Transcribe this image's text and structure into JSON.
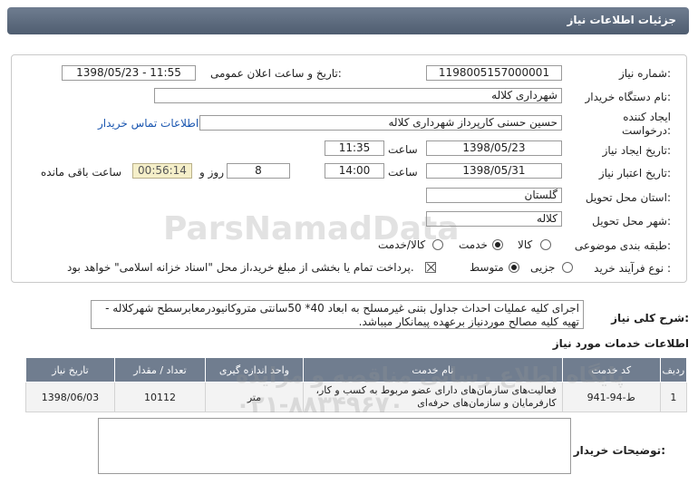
{
  "header": {
    "title": "جزئیات اطلاعات نیاز"
  },
  "form": {
    "need_number": {
      "label": "شماره نیاز:",
      "value": "1198005157000001"
    },
    "announce": {
      "label": "تاریخ و ساعت اعلان عمومی:",
      "value": "1398/05/23 - 11:55"
    },
    "buyer_org": {
      "label": "نام دستگاه خریدار:",
      "value": "شهرداری کلاله"
    },
    "creator": {
      "label_line1": "ایجاد کننده",
      "label_line2": "درخواست:",
      "value": "حسین حسنی کارپرداز شهرداری کلاله",
      "contact_link": "اطلاعات تماس خریدار"
    },
    "created": {
      "label": "تاریخ ایجاد نیاز:",
      "date": "1398/05/23",
      "time_label": "ساعت",
      "time": "11:35"
    },
    "validity": {
      "label": "تاریخ اعتبار نیاز:",
      "date": "1398/05/31",
      "time_label": "ساعت",
      "time": "14:00",
      "days": "8",
      "days_label": "روز و",
      "remaining": "00:56:14",
      "remaining_label": "ساعت باقی مانده"
    },
    "province": {
      "label": "استان محل تحویل:",
      "value": "گلستان"
    },
    "city": {
      "label": "شهر محل تحویل:",
      "value": "کلاله"
    },
    "category": {
      "label": "طبقه بندی موضوعی:",
      "options": [
        "کالا",
        "خدمت",
        "کالا/خدمت"
      ],
      "selected": "خدمت"
    },
    "purchase": {
      "label": "نوع فرآیند خرید :",
      "options": [
        "جزیی",
        "متوسط"
      ],
      "selected": "متوسط",
      "payment_note": "پرداخت تمام یا بخشی از مبلغ خرید،از محل \"اسناد خزانه اسلامی\" خواهد بود."
    }
  },
  "description": {
    "label": "شرح کلی نیاز:",
    "text": "اجرای کلیه عملیات احداث جداول بتنی غیرمسلح به ابعاد 40* 50سانتی متروکانیودرمعابرسطح شهرکلاله - تهیه کلیه مصالح موردنیاز برعهده پیمانکار میباشد."
  },
  "services": {
    "title": "اطلاعات خدمات مورد نیاز",
    "columns": [
      "ردیف",
      "کد خدمت",
      "نام خدمت",
      "واحد اندازه گیری",
      "تعداد / مقدار",
      "تاریخ نیاز"
    ],
    "rows": [
      {
        "index": "1",
        "code": "ط-94-941",
        "name": "فعالیت‌های سازمان‌های دارای عضو مربوط به کسب و کار، کارفرمایان و سازمان‌های حرفه‌ای",
        "unit": "متر",
        "qty": "10112",
        "date": "1398/06/03"
      }
    ]
  },
  "buyer_notes": {
    "label": "توضیحات خریدار:",
    "value": ""
  },
  "watermarks": {
    "site": "ParsNamadData",
    "persian": "پایگاه اطلاع رسانی مناقصه و مزایده",
    "phone": "۰۲۱-۸۸۳۴۹۶۷۰"
  }
}
